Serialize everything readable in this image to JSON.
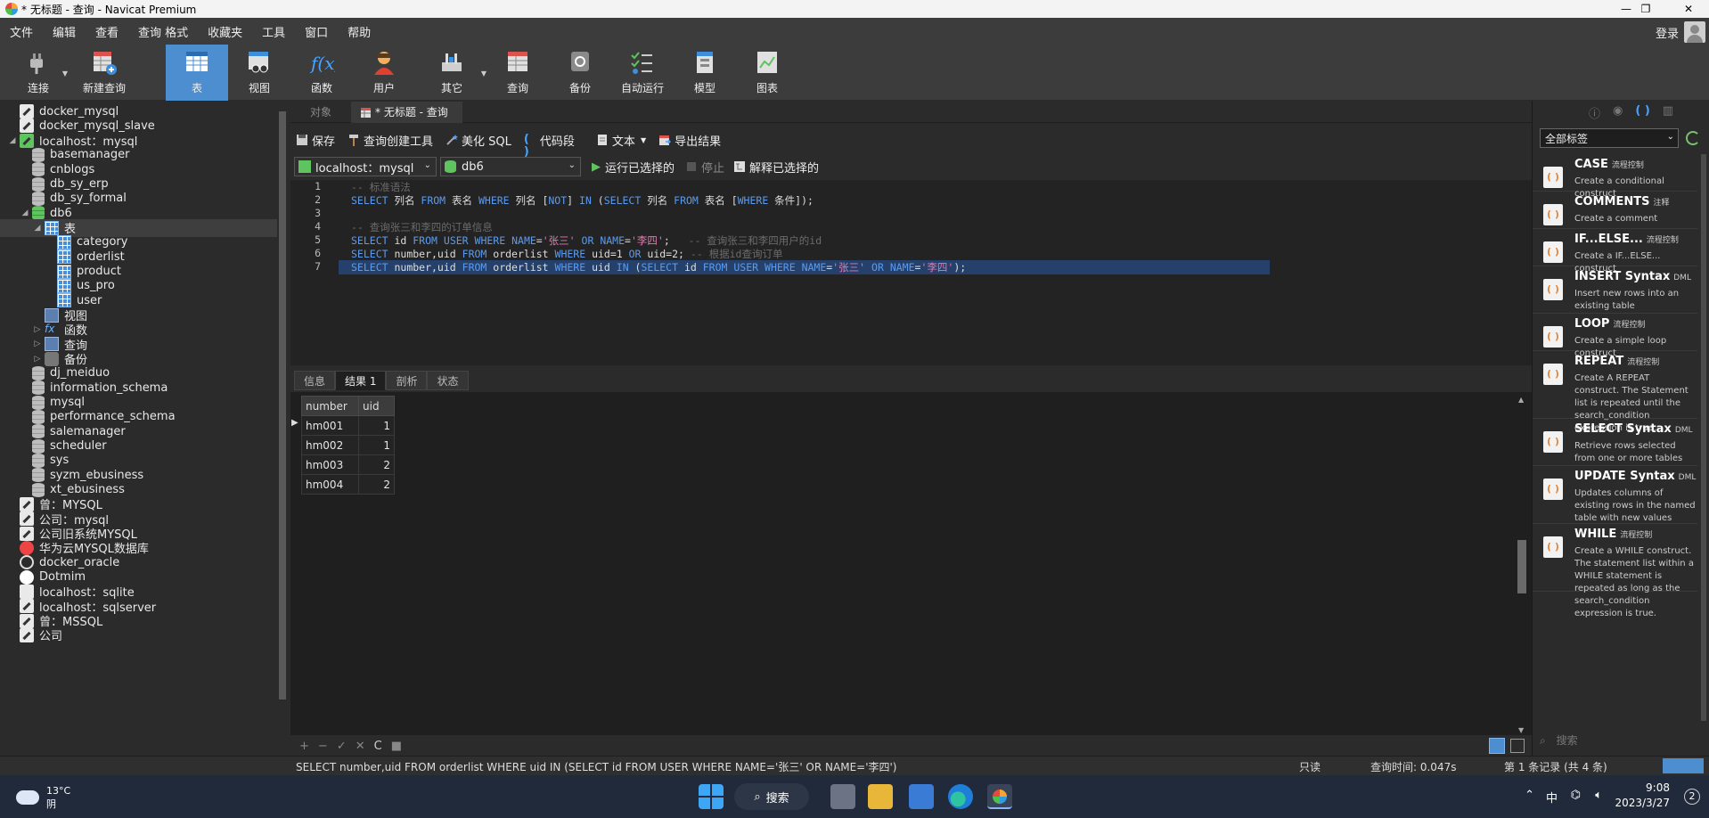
{
  "window": {
    "title": "* 无标题 - 查询 - Navicat Premium",
    "controls": [
      "—",
      "❐",
      "✕"
    ]
  },
  "menu": [
    "文件",
    "编辑",
    "查看",
    "查询",
    "格式",
    "收藏夹",
    "工具",
    "窗口",
    "帮助"
  ],
  "login_label": "登录",
  "toolbar": [
    {
      "label": "连接",
      "icon": "plug-icon",
      "has_dropdown": true
    },
    {
      "label": "新建查询",
      "icon": "new-query-icon"
    },
    {
      "label": "表",
      "icon": "table-icon",
      "active": true
    },
    {
      "label": "视图",
      "icon": "view-icon"
    },
    {
      "label": "函数",
      "icon": "function-icon"
    },
    {
      "label": "用户",
      "icon": "user-icon"
    },
    {
      "label": "其它",
      "icon": "tools-icon",
      "has_dropdown": true
    },
    {
      "label": "查询",
      "icon": "query-icon"
    },
    {
      "label": "备份",
      "icon": "backup-icon"
    },
    {
      "label": "自动运行",
      "icon": "checklist-icon"
    },
    {
      "label": "模型",
      "icon": "model-icon"
    },
    {
      "label": "图表",
      "icon": "chart-icon"
    }
  ],
  "tree": [
    {
      "label": "docker_mysql",
      "icon": "conn",
      "level": 0
    },
    {
      "label": "docker_mysql_slave",
      "icon": "conn",
      "level": 0
    },
    {
      "label": "localhost：mysql",
      "icon": "conn-on",
      "level": 0,
      "expanded": true
    },
    {
      "label": "basemanager",
      "icon": "db",
      "level": 1
    },
    {
      "label": "cnblogs",
      "icon": "db",
      "level": 1
    },
    {
      "label": "db_sy_erp",
      "icon": "db",
      "level": 1
    },
    {
      "label": "db_sy_formal",
      "icon": "db",
      "level": 1
    },
    {
      "label": "db6",
      "icon": "db-on",
      "level": 1,
      "expanded": true
    },
    {
      "label": "表",
      "icon": "tbl",
      "level": 2,
      "expanded": true,
      "selected": true
    },
    {
      "label": "category",
      "icon": "tbl",
      "level": 3
    },
    {
      "label": "orderlist",
      "icon": "tbl",
      "level": 3
    },
    {
      "label": "product",
      "icon": "tbl",
      "level": 3
    },
    {
      "label": "us_pro",
      "icon": "tbl",
      "level": 3
    },
    {
      "label": "user",
      "icon": "tbl",
      "level": 3
    },
    {
      "label": "视图",
      "icon": "view",
      "level": 2
    },
    {
      "label": "函数",
      "icon": "fx",
      "level": 2,
      "collapsed": true
    },
    {
      "label": "查询",
      "icon": "qry",
      "level": 2,
      "collapsed": true
    },
    {
      "label": "备份",
      "icon": "bak",
      "level": 2,
      "collapsed": true
    },
    {
      "label": "dj_meiduo",
      "icon": "db",
      "level": 1
    },
    {
      "label": "information_schema",
      "icon": "db",
      "level": 1
    },
    {
      "label": "mysql",
      "icon": "db",
      "level": 1
    },
    {
      "label": "performance_schema",
      "icon": "db",
      "level": 1
    },
    {
      "label": "salemanager",
      "icon": "db",
      "level": 1
    },
    {
      "label": "scheduler",
      "icon": "db",
      "level": 1
    },
    {
      "label": "sys",
      "icon": "db",
      "level": 1
    },
    {
      "label": "syzm_ebusiness",
      "icon": "db",
      "level": 1
    },
    {
      "label": "xt_ebusiness",
      "icon": "db",
      "level": 1
    },
    {
      "label": "曾：MYSQL",
      "icon": "conn",
      "level": 0
    },
    {
      "label": "公司：mysql",
      "icon": "conn",
      "level": 0
    },
    {
      "label": "公司旧系统MYSQL",
      "icon": "conn",
      "level": 0
    },
    {
      "label": "华为云MYSQL数据库",
      "icon": "hw",
      "level": 0
    },
    {
      "label": "docker_oracle",
      "icon": "ora",
      "level": 0
    },
    {
      "label": "Dotmim",
      "icon": "dot",
      "level": 0
    },
    {
      "label": "localhost：sqlite",
      "icon": "sqlite",
      "level": 0
    },
    {
      "label": "localhost：sqlserver",
      "icon": "conn",
      "level": 0
    },
    {
      "label": "曾：MSSQL",
      "icon": "conn",
      "level": 0
    },
    {
      "label": "公司",
      "icon": "conn",
      "level": 0
    }
  ],
  "tabs": {
    "objects": "对象",
    "active": "* 无标题 - 查询"
  },
  "query_toolbar": {
    "save": "保存",
    "builder": "查询创建工具",
    "beautify": "美化 SQL",
    "snippet": "代码段",
    "text": "文本",
    "export": "导出结果"
  },
  "query_select": {
    "connection": "localhost：mysql",
    "database": "db6",
    "run_selected": "运行已选择的",
    "stop": "停止",
    "explain": "解释已选择的"
  },
  "editor": {
    "line_numbers": [
      "1",
      "2",
      "3",
      "4",
      "5",
      "6",
      "7"
    ],
    "lines": [
      "-- 标准语法",
      "SELECT 列名 FROM 表名 WHERE 列名 [NOT] IN (SELECT 列名 FROM 表名 [WHERE 条件]);",
      "",
      "-- 查询张三和李四的订单信息",
      "SELECT id FROM USER WHERE NAME='张三' OR NAME='李四';   -- 查询张三和李四用户的id",
      "SELECT number,uid FROM orderlist WHERE uid=1 OR uid=2; -- 根据id查询订单",
      "SELECT number,uid FROM orderlist WHERE uid IN (SELECT id FROM USER WHERE NAME='张三' OR NAME='李四');"
    ]
  },
  "result_tabs": [
    "信息",
    "结果 1",
    "剖析",
    "状态"
  ],
  "result": {
    "columns": [
      "number",
      "uid"
    ],
    "rows": [
      [
        "hm001",
        "1"
      ],
      [
        "hm002",
        "1"
      ],
      [
        "hm003",
        "2"
      ],
      [
        "hm004",
        "2"
      ]
    ]
  },
  "result_toolbar": [
    "+",
    "−",
    "✓",
    "✕",
    "C",
    "■"
  ],
  "snippets_panel": {
    "filter": "全部标签",
    "search_placeholder": "搜索",
    "items": [
      {
        "title": "CASE",
        "tag": "流程控制",
        "desc": "Create a conditional construct"
      },
      {
        "title": "COMMENTS",
        "tag": "注释",
        "desc": "Create a comment"
      },
      {
        "title": "IF...ELSE...",
        "tag": "流程控制",
        "desc": "Create a IF...ELSE... construct"
      },
      {
        "title": "INSERT Syntax",
        "tag": "DML",
        "desc": "Insert new rows into an existing table"
      },
      {
        "title": "LOOP",
        "tag": "流程控制",
        "desc": "Create a simple loop construct"
      },
      {
        "title": "REPEAT",
        "tag": "流程控制",
        "desc": "Create A REPEAT construct. The Statement list is repeated until the search_condition expression is true."
      },
      {
        "title": "SELECT Syntax",
        "tag": "DML",
        "desc": "Retrieve rows selected from one or more tables"
      },
      {
        "title": "UPDATE Syntax",
        "tag": "DML",
        "desc": "Updates columns of existing rows in the named table with new values"
      },
      {
        "title": "WHILE",
        "tag": "流程控制",
        "desc": "Create a WHILE construct. The statement list within a WHILE statement is repeated as long as the search_condition expression is true."
      }
    ]
  },
  "status_bar": {
    "sql": "SELECT number,uid FROM orderlist WHERE uid IN (SELECT id FROM USER WHERE NAME='张三' OR NAME='李四')",
    "readonly": "只读",
    "query_time": "查询时间: 0.047s",
    "records": "第 1 条记录 (共 4 条)"
  },
  "taskbar": {
    "temp": "13°C",
    "weather": "阴",
    "search": "搜索",
    "ime": "中",
    "time": "9:08",
    "date": "2023/3/27",
    "notifications": "2"
  }
}
